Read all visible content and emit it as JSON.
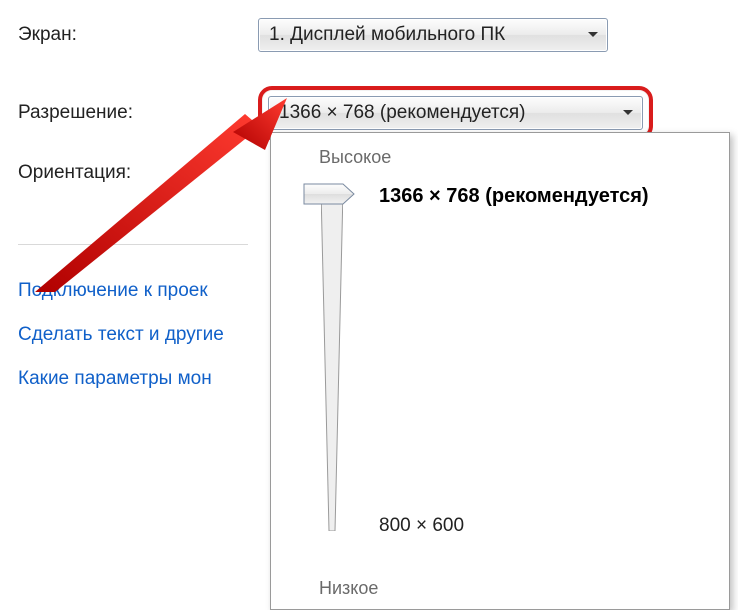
{
  "labels": {
    "screen": "Экран:",
    "resolution": "Разрешение:",
    "orientation": "Ориентация:"
  },
  "combos": {
    "screen_value": "1. Дисплей мобильного ПК",
    "resolution_value": "1366 × 768 (рекомендуется)"
  },
  "slider": {
    "high": "Высокое",
    "low": "Низкое",
    "top_res": "1366 × 768 (рекомендуется)",
    "bottom_res": "800 × 600"
  },
  "links": {
    "projector": "Подключение к проек",
    "text_size": "Сделать текст и другие",
    "monitor_params": "Какие параметры мон"
  }
}
